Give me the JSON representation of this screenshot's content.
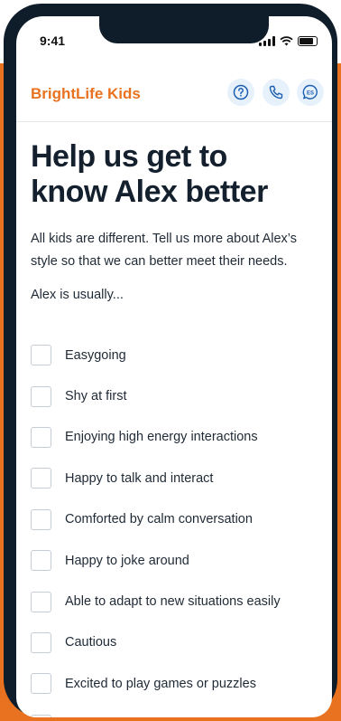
{
  "status_bar": {
    "time": "9:41"
  },
  "header": {
    "logo": "BrightLife Kids",
    "help_icon": "help-circle-icon",
    "phone_icon": "phone-icon",
    "language_label": "ES"
  },
  "main": {
    "title_line1": "Help us get to",
    "title_line2": "know Alex better",
    "intro": "All kids are different. Tell us more about Alex’s style so that we can better meet their needs.",
    "prompt": "Alex is usually...",
    "options": [
      {
        "label": "Easygoing",
        "checked": false
      },
      {
        "label": "Shy at first",
        "checked": false
      },
      {
        "label": "Enjoying high energy interactions",
        "checked": false
      },
      {
        "label": "Happy to talk and interact",
        "checked": false
      },
      {
        "label": "Comforted by calm conversation",
        "checked": false
      },
      {
        "label": "Happy to joke around",
        "checked": false
      },
      {
        "label": "Able to adapt to new situations easily",
        "checked": false
      },
      {
        "label": "Cautious",
        "checked": false
      },
      {
        "label": "Excited to play games or puzzles",
        "checked": false
      }
    ]
  },
  "colors": {
    "brand_orange": "#e8721f",
    "heading": "#14202e",
    "icon_bg": "#e6f1fb",
    "icon_blue": "#1d5fb0"
  }
}
